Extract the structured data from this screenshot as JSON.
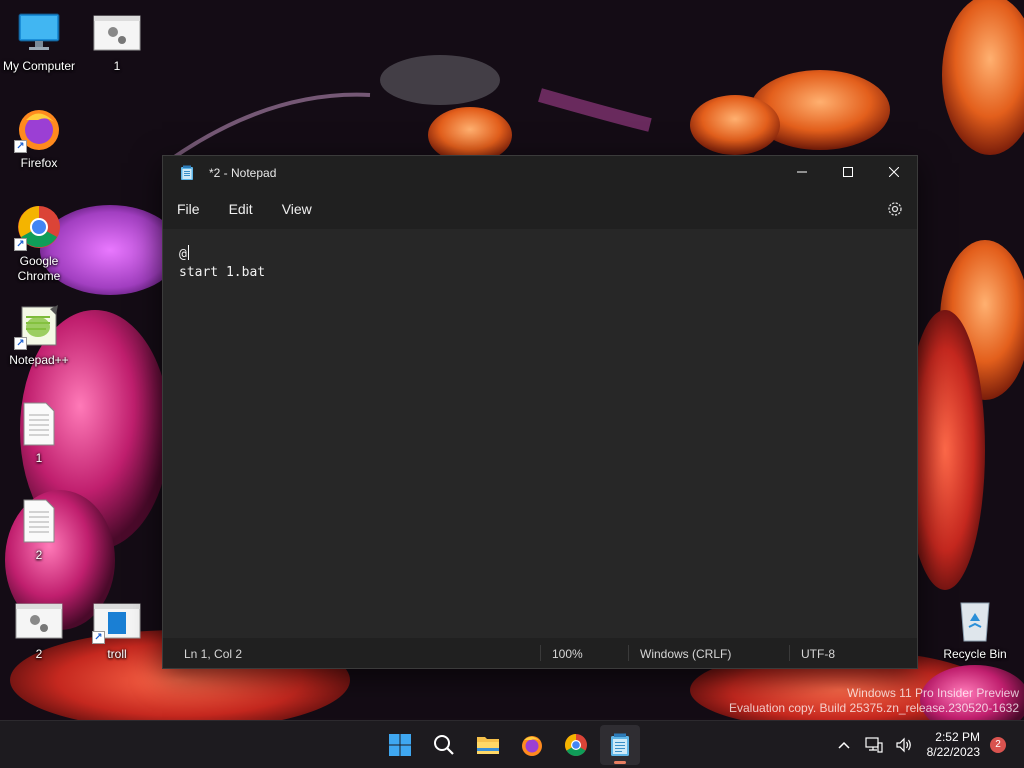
{
  "desktop": {
    "icons": [
      {
        "label": "My Computer"
      },
      {
        "label": "1"
      },
      {
        "label": "Firefox"
      },
      {
        "label": "Google Chrome"
      },
      {
        "label": "Notepad++"
      },
      {
        "label": "1"
      },
      {
        "label": "2"
      },
      {
        "label": "2"
      },
      {
        "label": "troll"
      },
      {
        "label": "Recycle Bin"
      }
    ]
  },
  "notepad": {
    "title": "*2 - Notepad",
    "menu": [
      "File",
      "Edit",
      "View"
    ],
    "content": {
      "line1": "@",
      "line2": "start 1.bat"
    },
    "status": {
      "position": "Ln 1, Col 2",
      "zoom": "100%",
      "line_ending": "Windows (CRLF)",
      "encoding": "UTF-8"
    }
  },
  "watermark": {
    "line1": "Windows 11 Pro Insider Preview",
    "line2": "Evaluation copy. Build 25375.zn_release.230520-1632"
  },
  "taskbar": {
    "apps": [
      "start-icon",
      "search-icon",
      "file-explorer-icon",
      "firefox-icon",
      "chrome-icon",
      "notepad-icon"
    ],
    "time": "2:52 PM",
    "date": "8/22/2023",
    "notification_count": "2"
  },
  "colors": {
    "accent": "#e87f62",
    "window_bg": "#272727",
    "chrome_bg": "#202020"
  }
}
